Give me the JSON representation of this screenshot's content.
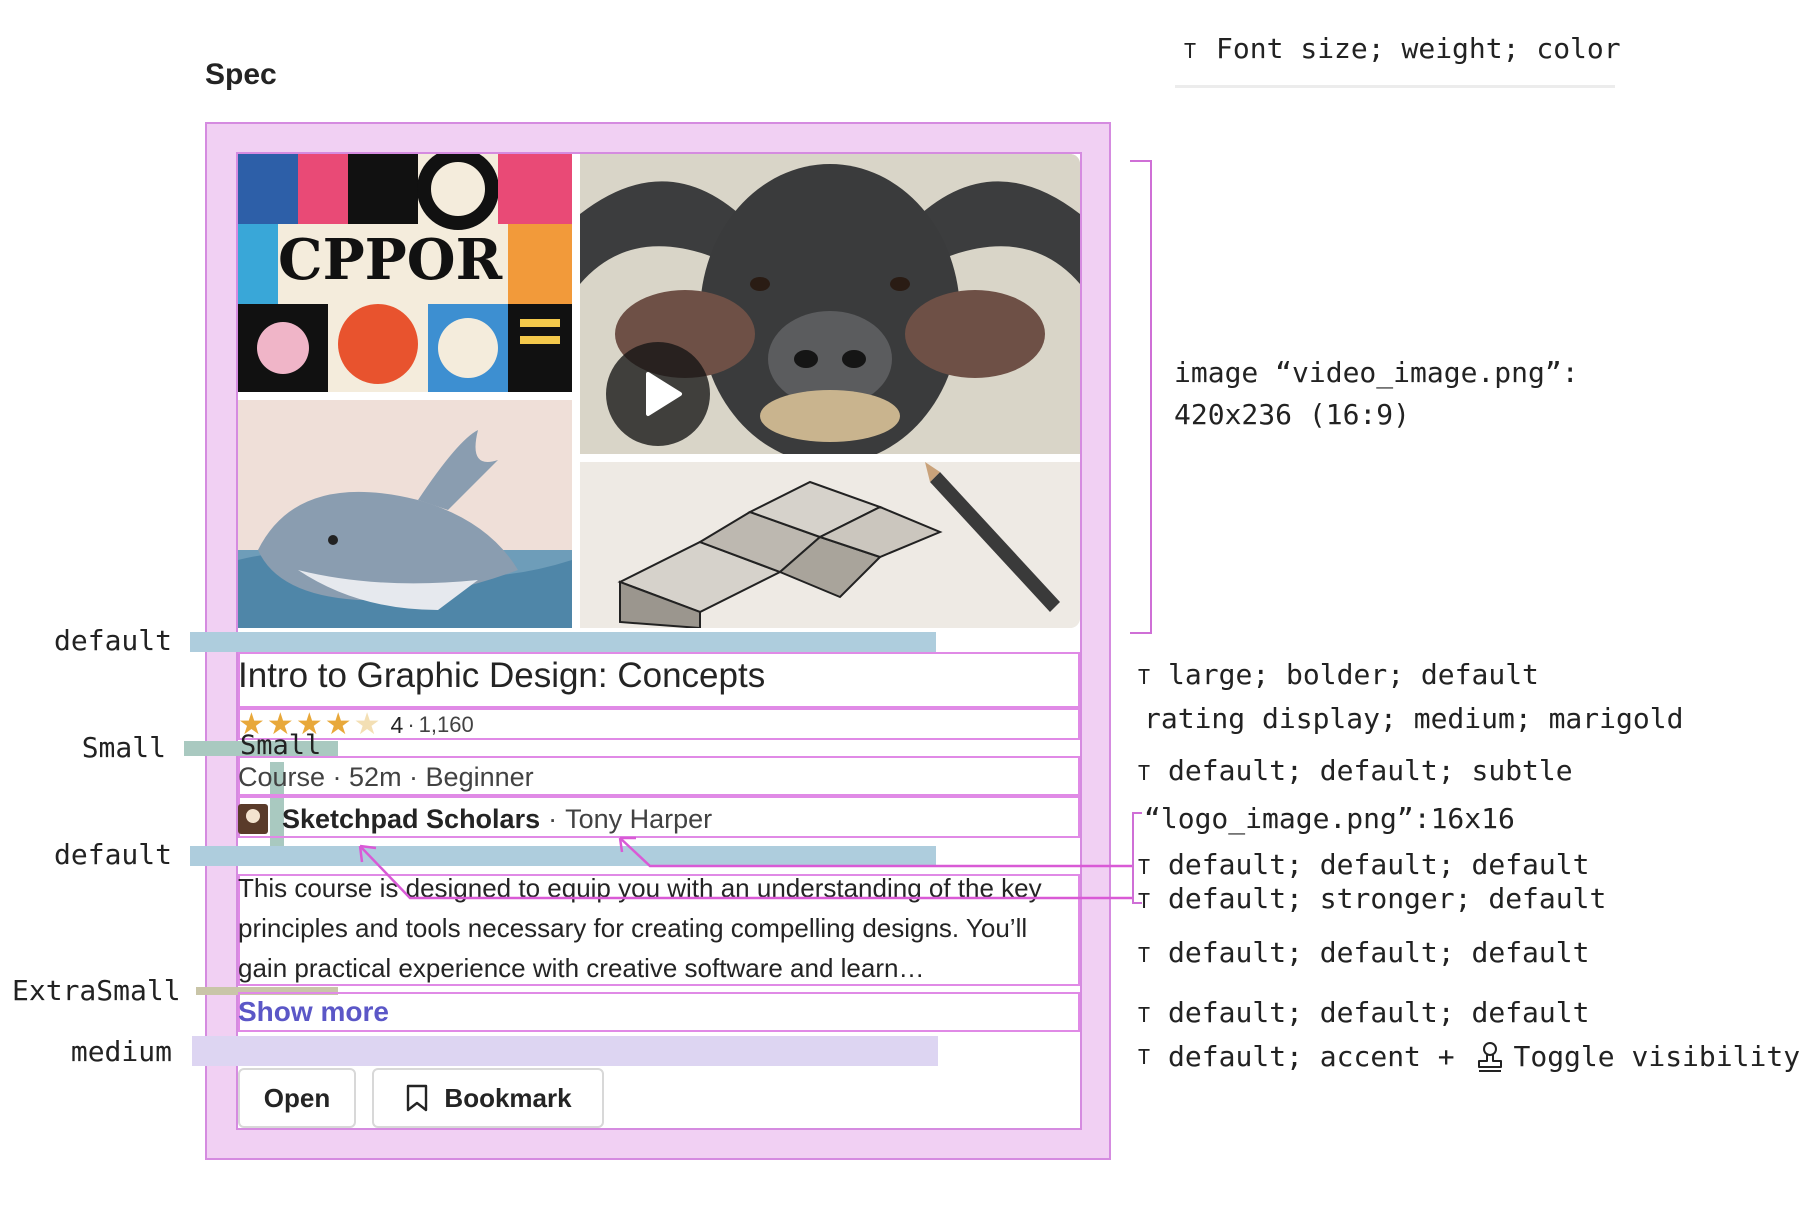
{
  "spec_title": "Spec",
  "legend": {
    "icon": "T",
    "text": "Font size; weight; color"
  },
  "image_spec": {
    "line1": "image “video_image.png”:",
    "line2": "420x236 (16:9)"
  },
  "spacing_labels": {
    "default_1": "default",
    "small_1": "Small",
    "small_overlay": "Small",
    "default_2": "default",
    "extrasmall": "ExtraSmall",
    "medium": "medium"
  },
  "card": {
    "title": "Intro to Graphic Design: Concepts",
    "rating": {
      "stars_filled": 4,
      "stars_total": 5,
      "value": "4",
      "separator": "·",
      "count": "1,160"
    },
    "meta": "Course · 52m · Beginner",
    "author": {
      "org": "Sketchpad Scholars",
      "separator": "·",
      "name": "Tony Harper"
    },
    "description": "This course is designed to equip you with an understanding of the key principles and tools necessary for creating compelling designs. You’ll gain practical experience with creative software and learn…",
    "show_more": "Show more",
    "buttons": {
      "open": "Open",
      "bookmark": "Bookmark"
    }
  },
  "annotations": {
    "icon": "T",
    "title": "large; bolder; default",
    "rating": "rating display; medium; marigold",
    "meta": "default; default; subtle",
    "logo": "“logo_image.png”:16x16",
    "author_name": "default; default; default",
    "author_org": "default; stronger; default",
    "description": "default; default; default",
    "show_more": "default; default; default",
    "buttons": "default; accent + ",
    "buttons_suffix": "Toggle visibility"
  },
  "colors": {
    "spec_fill": "#f1d0f3",
    "spec_border": "#d58be0",
    "spacing_default": "#aecddd",
    "spacing_small": "#a9c9c0",
    "spacing_extrasmall": "#c9c5a8",
    "spacing_medium": "#ddd5f2",
    "star": "#e8a83a",
    "accent": "#5b57c7"
  }
}
